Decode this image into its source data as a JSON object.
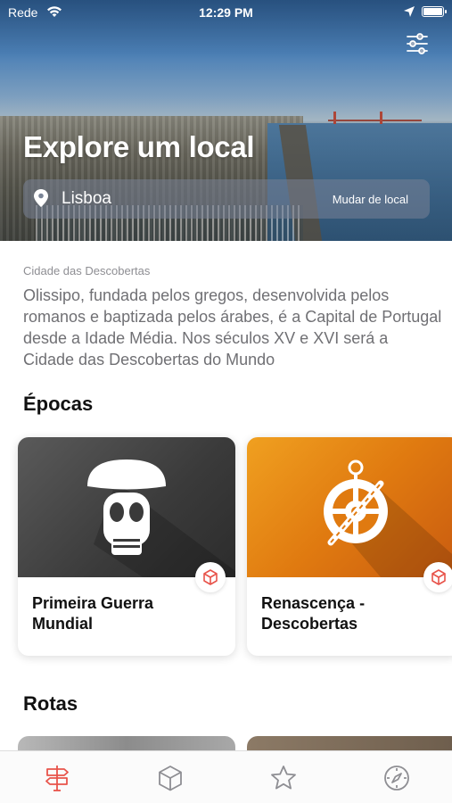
{
  "status_bar": {
    "carrier": "Rede",
    "time": "12:29 PM"
  },
  "hero": {
    "title": "Explore um local",
    "location": "Lisboa",
    "change_location_label": "Mudar de local"
  },
  "intro": {
    "kicker": "Cidade das Descobertas",
    "description": "Olissipo, fundada pelos gregos, desenvolvida pelos romanos e baptizada pelos árabes, é a Capital de Portugal desde a Idade Média. Nos séculos XV e XVI será a Cidade das Descobertas do Mundo"
  },
  "epochs": {
    "title": "Épocas",
    "cards": [
      {
        "label": "Primeira Guerra Mundial",
        "icon": "gas-mask-icon"
      },
      {
        "label": "Renascença - Descobertas",
        "icon": "ship-wheel-icon"
      }
    ]
  },
  "routes": {
    "title": "Rotas"
  },
  "tab_bar": {
    "tabs": [
      {
        "icon": "signpost-icon",
        "active": true
      },
      {
        "icon": "cube-icon",
        "active": false
      },
      {
        "icon": "star-icon",
        "active": false
      },
      {
        "icon": "compass-icon",
        "active": false
      }
    ]
  },
  "colors": {
    "accent": "#e8534a",
    "tab_inactive": "#8e8e93",
    "epoch1": "#3a3a3a",
    "epoch2": "#e07a10"
  }
}
